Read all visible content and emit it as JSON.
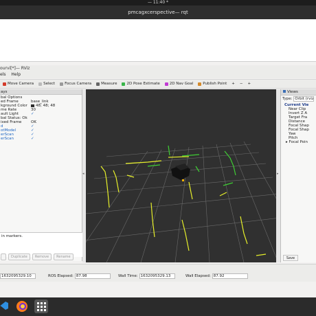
{
  "system": {
    "clock": "— 11:40 *"
  },
  "window": {
    "title": "pmcagxcerspective— rqt"
  },
  "rviz": {
    "title": "ourvi[*]— RViz",
    "menu": [
      "els",
      "Help"
    ]
  },
  "toolbar": {
    "tools": [
      {
        "label": "Move Camera",
        "icon": "move-camera-icon",
        "color": "#d43c2b"
      },
      {
        "label": "Select",
        "icon": "select-icon",
        "color": "#bbbbbb"
      },
      {
        "label": "Focus Camera",
        "icon": "focus-camera-icon",
        "color": "#9a9a9a"
      },
      {
        "label": "Measure",
        "icon": "measure-icon",
        "color": "#666666"
      },
      {
        "label": "2D Pose Estimate",
        "icon": "pose-estimate-icon",
        "color": "#39b54a"
      },
      {
        "label": "2D Nav Goal",
        "icon": "nav-goal-icon",
        "color": "#c23bd4"
      },
      {
        "label": "Publish Point",
        "icon": "publish-point-icon",
        "color": "#d48a2b"
      }
    ],
    "extras": [
      "+",
      "−",
      "+"
    ]
  },
  "displays": {
    "header": "ays",
    "rows": [
      {
        "key": "bal Options",
        "value": ""
      },
      {
        "key": "ed Frame",
        "value": "base_link"
      },
      {
        "key": "kground Color",
        "value": "48; 48; 48",
        "swatch": "#303030"
      },
      {
        "key": "me Rate",
        "value": "30"
      },
      {
        "key": "ault Light",
        "value": "✓"
      },
      {
        "key": "bal Status: Ok",
        "value": ""
      },
      {
        "key": "ixed Frame",
        "value": "OK"
      },
      {
        "key": "d",
        "value": "✓",
        "blue": true
      },
      {
        "key": "otModel",
        "value": "✓",
        "blue": true
      },
      {
        "key": "erScan",
        "value": "✓",
        "blue": true
      },
      {
        "key": "erScan",
        "value": "✓",
        "blue": true
      }
    ],
    "description": "in markers.",
    "buttons": [
      "",
      "Duplicate",
      "Remove",
      "Rename"
    ]
  },
  "views": {
    "header": "Views",
    "type_label": "Type:",
    "type_value": "Orbit (rviz",
    "items": [
      {
        "label": "Current Vie",
        "top": true
      },
      {
        "label": "Near Clip"
      },
      {
        "label": "Invert Z A"
      },
      {
        "label": "Target Fra"
      },
      {
        "label": "Distance"
      },
      {
        "label": "Focal Shap"
      },
      {
        "label": "Focal Shap"
      },
      {
        "label": "Yaw"
      },
      {
        "label": "Pitch"
      },
      {
        "label": "Focal Poin",
        "last": true
      }
    ],
    "save_label": "Save"
  },
  "time": {
    "ros_time_value": "1632095329.10",
    "ros_elapsed_label": "ROS Elapsed:",
    "ros_elapsed_value": "87.98",
    "wall_time_label": "Wall Time:",
    "wall_time_value": "1632095329.13",
    "wall_elapsed_label": "Wall Elapsed:",
    "wall_elapsed_value": "87.92"
  },
  "dock": {
    "apps": [
      {
        "name": "vscode-icon",
        "color": "#2f8fe0"
      },
      {
        "name": "firefox-icon",
        "color": "#ff7b1c"
      },
      {
        "name": "app-grid-icon",
        "color": "#ffffff"
      }
    ]
  }
}
